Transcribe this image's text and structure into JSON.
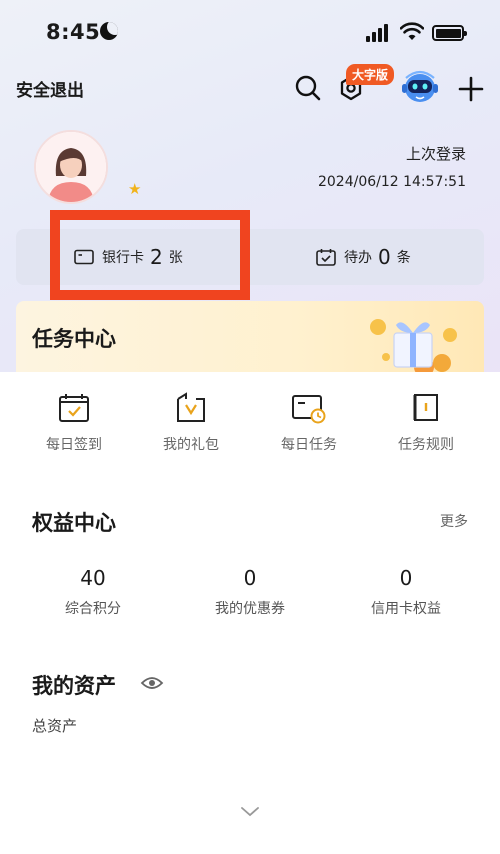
{
  "status_bar": {
    "time": "8:45"
  },
  "header": {
    "logout_label": "安全退出",
    "big_font_badge": "大字版"
  },
  "profile": {
    "last_login_label": "上次登录",
    "last_login_time": "2024/06/12 14:57:51"
  },
  "summary": {
    "bank_card": {
      "label": "银行卡",
      "count": "2",
      "unit": "张"
    },
    "todo": {
      "label": "待办",
      "count": "0",
      "unit": "条"
    }
  },
  "task_center": {
    "title": "任务中心",
    "items": [
      {
        "label": "每日签到",
        "icon": "calendar-check-icon"
      },
      {
        "label": "我的礼包",
        "icon": "gift-package-icon"
      },
      {
        "label": "每日任务",
        "icon": "task-card-icon"
      },
      {
        "label": "任务规则",
        "icon": "rules-book-icon"
      }
    ]
  },
  "rights_center": {
    "title": "权益中心",
    "more_label": "更多",
    "stats": [
      {
        "value": "40",
        "label": "综合积分"
      },
      {
        "value": "0",
        "label": "我的优惠券"
      },
      {
        "value": "0",
        "label": "信用卡权益"
      }
    ]
  },
  "assets": {
    "title": "我的资产",
    "total_label": "总资产"
  },
  "colors": {
    "accent_orange": "#f05a24",
    "highlight_red": "#f0441f",
    "icon_gold": "#e9a31b"
  }
}
